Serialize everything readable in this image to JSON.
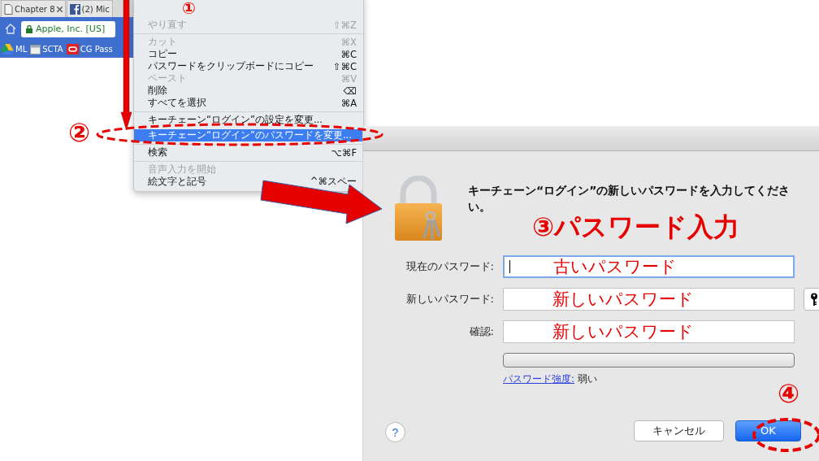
{
  "browser": {
    "tabs": [
      {
        "title": "Chapter 8"
      },
      {
        "title": "(2) Mic"
      }
    ],
    "address": "Apple, Inc. [US]",
    "bookmarks": [
      {
        "label": "ML"
      },
      {
        "label": "SCTA"
      },
      {
        "label": "CG Pass"
      }
    ]
  },
  "menu": {
    "items": [
      {
        "kind": "item",
        "label": "やり直す",
        "shortcut": "⇧⌘Z",
        "disabled": true,
        "selected": false
      },
      {
        "kind": "separator"
      },
      {
        "kind": "item",
        "label": "カット",
        "shortcut": "⌘X",
        "disabled": true,
        "selected": false
      },
      {
        "kind": "item",
        "label": "コピー",
        "shortcut": "⌘C",
        "disabled": false,
        "selected": false
      },
      {
        "kind": "item",
        "label": "パスワードをクリップボードにコピー",
        "shortcut": "⇧⌘C",
        "disabled": false,
        "selected": false
      },
      {
        "kind": "item",
        "label": "ペースト",
        "shortcut": "⌘V",
        "disabled": true,
        "selected": false
      },
      {
        "kind": "item",
        "label": "削除",
        "shortcut": "⌫",
        "disabled": false,
        "selected": false
      },
      {
        "kind": "item",
        "label": "すべてを選択",
        "shortcut": "⌘A",
        "disabled": false,
        "selected": false
      },
      {
        "kind": "separator"
      },
      {
        "kind": "item",
        "label": "キーチェーン“ログイン”の設定を変更...",
        "disabled": false,
        "selected": false
      },
      {
        "kind": "item",
        "label": "キーチェーン“ログイン”のパスワードを変更...",
        "disabled": false,
        "selected": true
      },
      {
        "kind": "separator"
      },
      {
        "kind": "item",
        "label": "検索",
        "shortcut": "⌥⌘F",
        "disabled": false,
        "selected": false
      },
      {
        "kind": "separator"
      },
      {
        "kind": "item",
        "label": "音声入力を開始",
        "disabled": true,
        "selected": false
      },
      {
        "kind": "item",
        "label": "絵文字と記号",
        "shortcut": "^⌘スペー",
        "disabled": false,
        "selected": false
      }
    ]
  },
  "dialog": {
    "message": "キーチェーン“ログイン”の新しいパスワードを入力してください。",
    "fields": [
      {
        "label": "現在のパスワード:",
        "value": "古いパスワード",
        "focused": true,
        "key_button": false
      },
      {
        "label": "新しいパスワード:",
        "value": "新しいパスワード",
        "focused": false,
        "key_button": true
      },
      {
        "label": "確認:",
        "value": "新しいパスワード",
        "focused": false,
        "key_button": false
      }
    ],
    "strength": {
      "link": "パスワード強度:",
      "value": "弱い",
      "level": 0
    },
    "help": "?",
    "buttons": [
      {
        "label": "キャンセル",
        "default": false
      },
      {
        "label": "OK",
        "default": true
      }
    ]
  },
  "annotations": {
    "steps": [
      "①",
      "②",
      "③パスワード入力",
      "④"
    ]
  }
}
